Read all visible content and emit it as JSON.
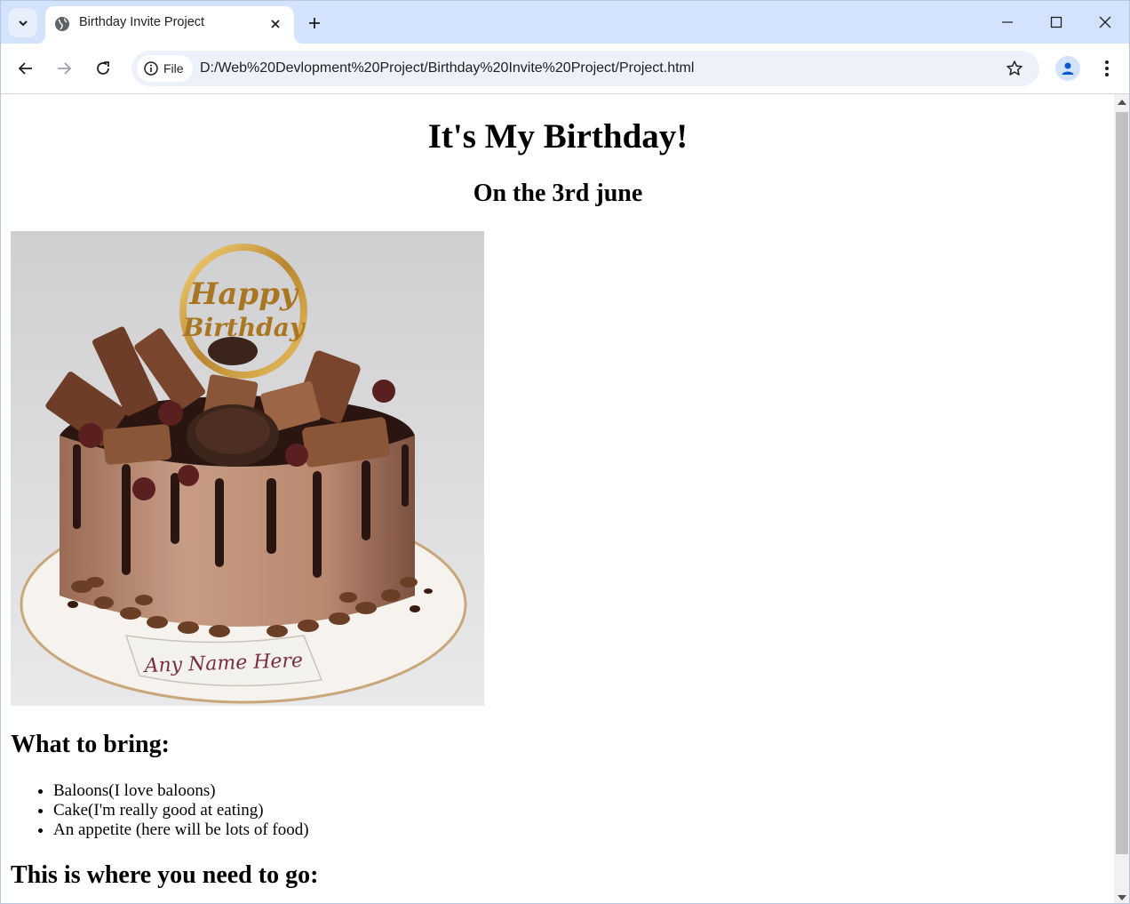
{
  "browser": {
    "tab": {
      "title": "Birthday Invite Project",
      "favicon": "globe-icon"
    },
    "new_tab_icon": "plus-icon",
    "url_chip": "File",
    "url": "D:/Web%20Devlopment%20Project/Birthday%20Invite%20Project/Project.html",
    "accent": "#d3e3fd"
  },
  "page": {
    "title": "It's My Birthday!",
    "subtitle": "On the 3rd june",
    "cake_image": {
      "banner_text": "Any Name Here",
      "topper_text_1": "Happy",
      "topper_text_2": "Birthday"
    },
    "bring_heading": "What to bring:",
    "bring_items": [
      "Baloons(I love baloons)",
      "Cake(I'm really good at eating)",
      "An appetite (here will be lots of food)"
    ],
    "go_heading": "This is where you need to go:"
  }
}
